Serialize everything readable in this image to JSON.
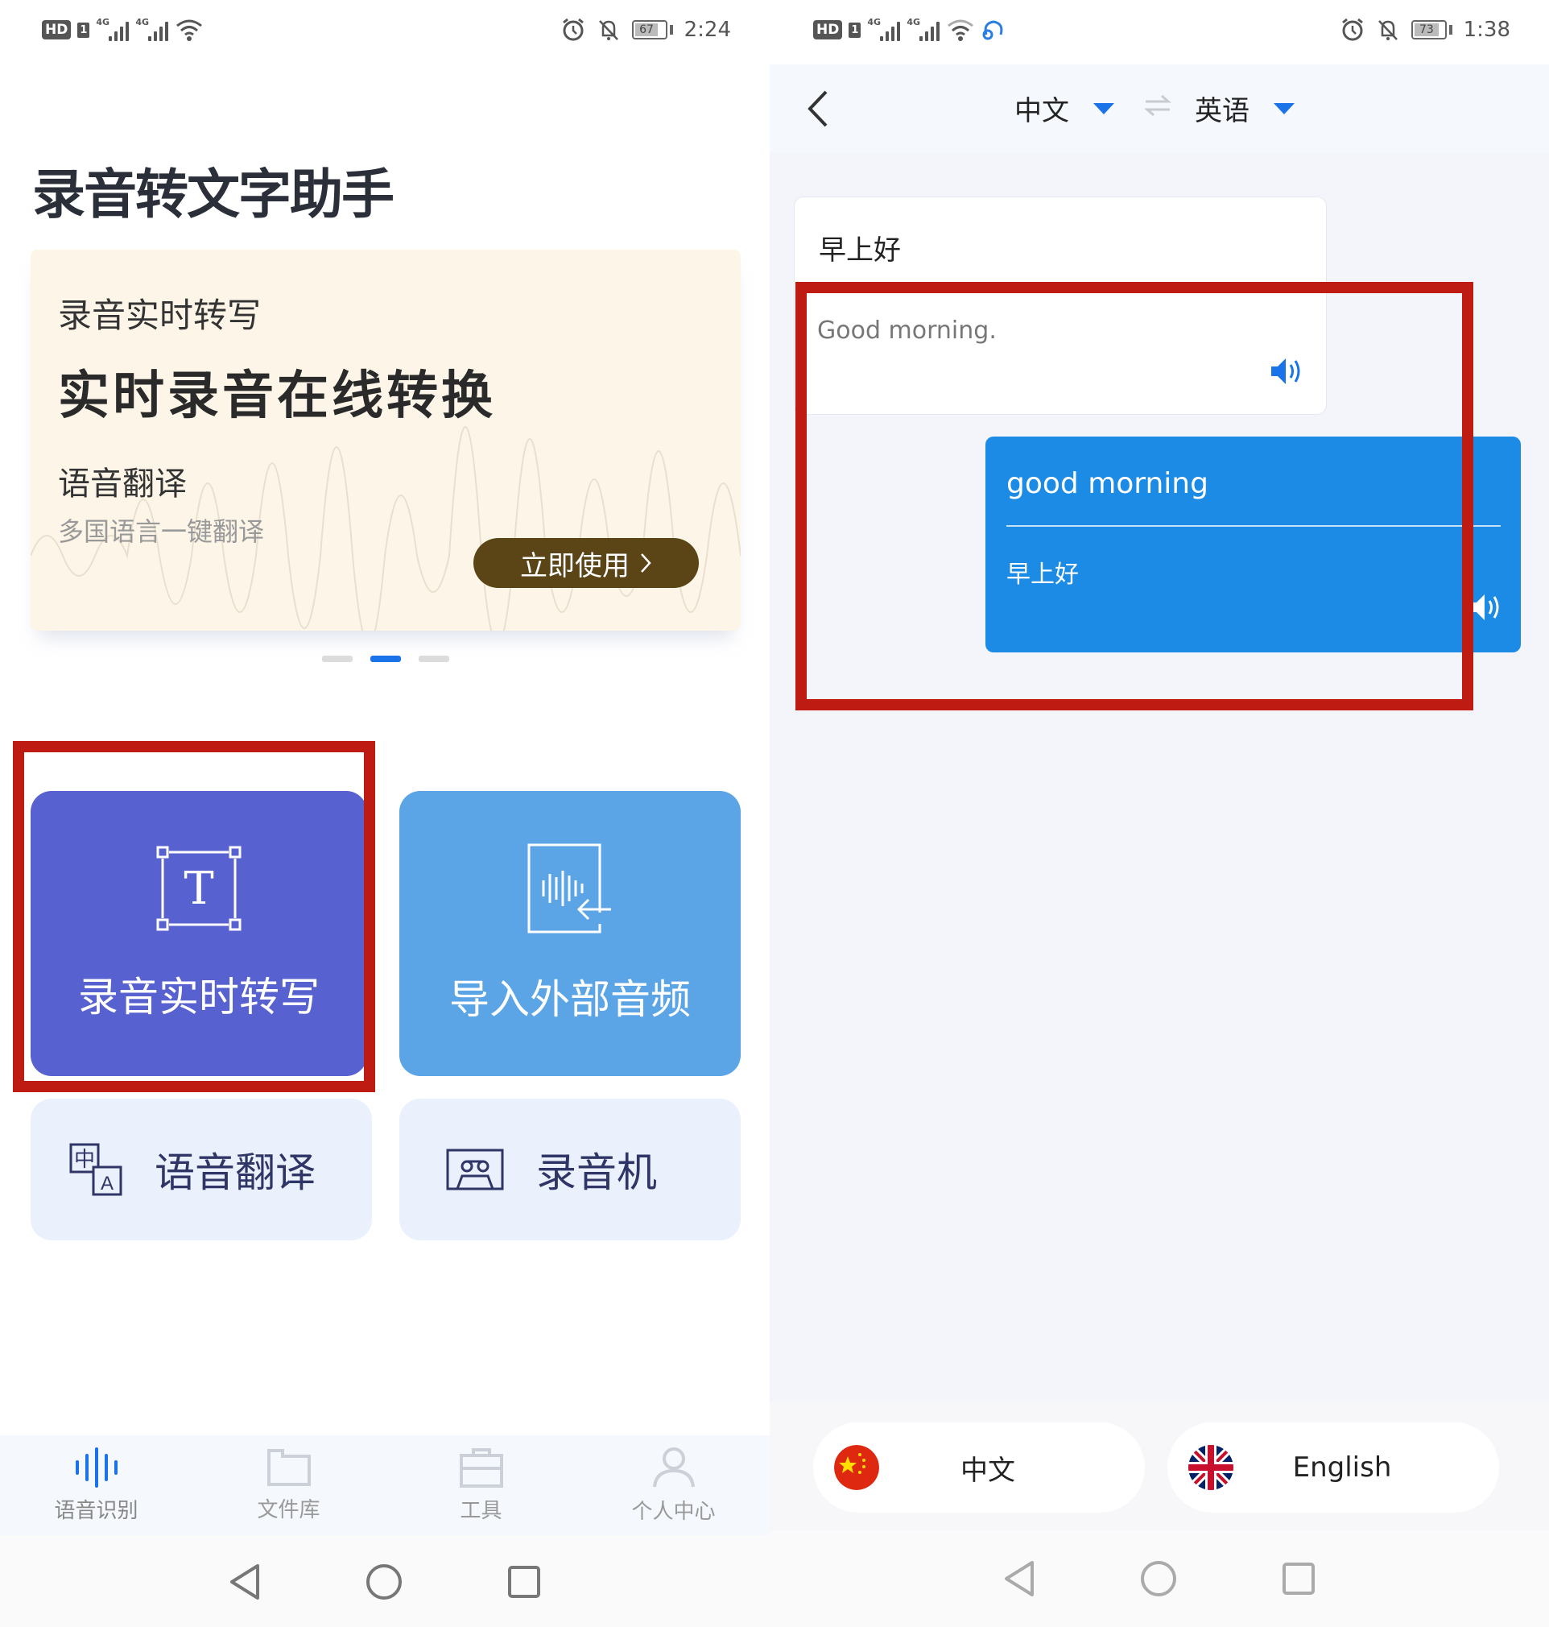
{
  "left_screen": {
    "status_bar": {
      "hd_label": "HD",
      "sim_label": "1",
      "network_1": "4G",
      "network_2": "4G",
      "battery_percent": "67",
      "time": "2:24"
    },
    "app_title": "录音转文字助手",
    "banner": {
      "subtitle": "录音实时转写",
      "headline": "实时录音在线转换",
      "feature": "语音翻译",
      "description": "多国语言一键翻译",
      "cta_label": "立即使用",
      "cta_icon": "chevron-right-icon",
      "pagination": {
        "total": 3,
        "active_index": 1
      }
    },
    "tiles": [
      {
        "label": "录音实时转写",
        "icon": "text-box-icon",
        "color": "#5761d0",
        "highlighted": true
      },
      {
        "label": "导入外部音频",
        "icon": "import-audio-icon",
        "color": "#5ba4e5"
      },
      {
        "label": "语音翻译",
        "icon": "translate-icon"
      },
      {
        "label": "录音机",
        "icon": "cassette-icon"
      }
    ],
    "bottom_nav": [
      {
        "label": "语音识别",
        "icon": "waveform-icon",
        "active": true
      },
      {
        "label": "文件库",
        "icon": "folder-icon"
      },
      {
        "label": "工具",
        "icon": "toolbox-icon"
      },
      {
        "label": "个人中心",
        "icon": "user-icon"
      }
    ]
  },
  "right_screen": {
    "status_bar": {
      "hd_label": "HD",
      "sim_label": "1",
      "network_1": "4G",
      "network_2": "4G",
      "battery_percent": "73",
      "time": "1:38"
    },
    "header": {
      "source_language": "中文",
      "target_language": "英语"
    },
    "messages": [
      {
        "type": "input",
        "source_text": "早上好",
        "translation": "Good morning.",
        "highlighted": true
      },
      {
        "type": "response",
        "source_text": "good morning",
        "translation": "早上好"
      }
    ],
    "language_buttons": [
      {
        "label": "中文",
        "flag": "china-flag-icon"
      },
      {
        "label": "English",
        "flag": "uk-flag-icon"
      }
    ]
  },
  "colors": {
    "accent_blue": "#1a73e8",
    "bubble_blue": "#1b8be6",
    "highlight_red": "#be1c12",
    "banner_button": "#5b4517"
  }
}
